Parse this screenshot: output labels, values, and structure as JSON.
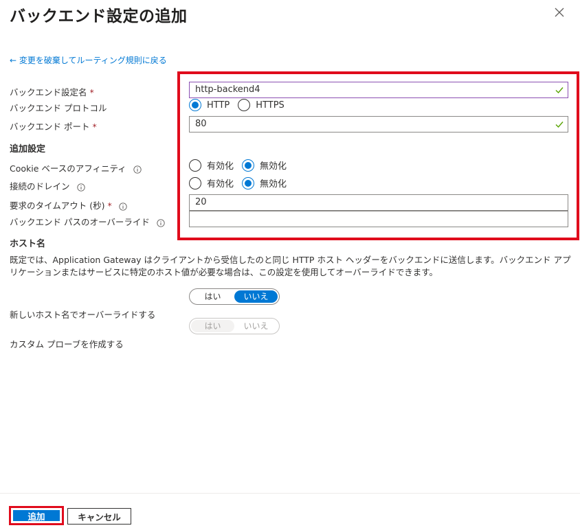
{
  "header": {
    "title": "バックエンド設定の追加"
  },
  "back_link": "← 変更を破棄してルーティング規則に戻る",
  "form": {
    "backend_setting_name": {
      "label": "バックエンド設定名",
      "required_mark": "*",
      "value": "http-backend4"
    },
    "backend_protocol": {
      "label": "バックエンド プロトコル",
      "options": [
        "HTTP",
        "HTTPS"
      ],
      "selected": "HTTP"
    },
    "backend_port": {
      "label": "バックエンド ポート",
      "required_mark": "*",
      "value": "80"
    },
    "additional_settings_heading": "追加設定",
    "cookie_affinity": {
      "label": "Cookie ベースのアフィニティ",
      "options": [
        "有効化",
        "無効化"
      ],
      "selected": "無効化"
    },
    "connection_draining": {
      "label": "接続のドレイン",
      "options": [
        "有効化",
        "無効化"
      ],
      "selected": "無効化"
    },
    "request_timeout": {
      "label": "要求のタイムアウト (秒)",
      "required_mark": "*",
      "value": "20"
    },
    "backend_path_override": {
      "label": "バックエンド パスのオーバーライド",
      "value": ""
    }
  },
  "host_name": {
    "heading": "ホスト名",
    "description": "既定では、Application Gateway はクライアントから受信したのと同じ HTTP ホスト ヘッダーをバックエンドに送信します。バックエンド アプリケーションまたはサービスに特定のホスト値が必要な場合は、この設定を使用してオーバーライドできます。",
    "override_toggle": {
      "label": "新しいホスト名でオーバーライドする",
      "yes": "はい",
      "no": "いいえ",
      "selected": "いいえ"
    },
    "custom_probe_toggle": {
      "label": "カスタム プローブを作成する",
      "yes": "はい",
      "no": "いいえ",
      "disabled": true
    }
  },
  "footer": {
    "add_label": "追加",
    "cancel_label": "キャンセル"
  },
  "colors": {
    "accent": "#0078d4",
    "highlight": "#e00b1c",
    "valid_check": "#57a300"
  }
}
